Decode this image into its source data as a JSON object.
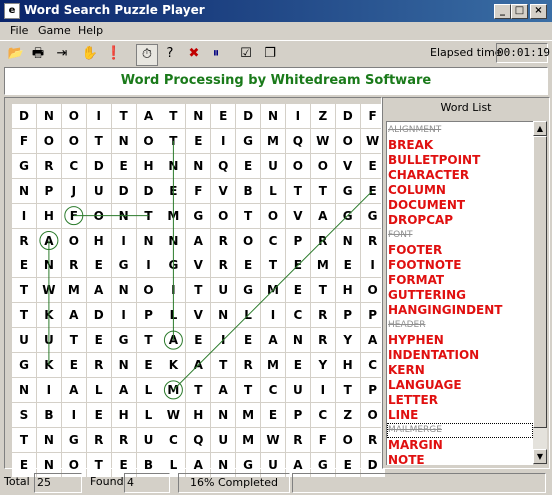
{
  "window": {
    "title": "Word Search Puzzle Player",
    "app_icon": "document-icon"
  },
  "menu": [
    "File",
    "Game",
    "Help"
  ],
  "toolbar": {
    "buttons": [
      {
        "name": "open-button",
        "icon": "folder-open-icon",
        "glyph": "📂"
      },
      {
        "name": "print-button",
        "icon": "printer-icon",
        "glyph": "🖶"
      },
      {
        "name": "exit-button",
        "icon": "exit-door-icon",
        "glyph": "⇥"
      },
      {
        "name": "hand-button",
        "icon": "hand-icon",
        "glyph": "✋"
      },
      {
        "name": "stop-button",
        "icon": "stop-icon",
        "glyph": "❗"
      },
      {
        "name": "timer-button",
        "icon": "stopwatch-icon",
        "glyph": "⏱"
      },
      {
        "name": "hint-button",
        "icon": "hint-icon",
        "glyph": "?"
      },
      {
        "name": "reveal-button",
        "icon": "cross-icon",
        "glyph": "✖"
      },
      {
        "name": "pause-button",
        "icon": "pause-icon",
        "glyph": "⏸"
      },
      {
        "name": "checklist-button",
        "icon": "checklist-icon",
        "glyph": "☑"
      },
      {
        "name": "window-button",
        "icon": "window-icon",
        "glyph": "❐"
      }
    ],
    "elapsed_label": "Elapsed time",
    "elapsed_value": "00:01:19"
  },
  "banner": "Word Processing by Whitedream Software",
  "grid": [
    "DNOITATNEDNIZDF",
    "FOOTNOTEIGMQWOW",
    "GRCDEHNNQEUOOVE",
    "NPJUDDEFVBLTTGE",
    "IHFONTMGOTOVAGG",
    "RAOHINNAROCPRNR",
    "ENREGIGVRETEMEI",
    "TWMANOITUGMETHO",
    "TKADIPLVNLICRPP",
    "UUTEGTAEIEANRYA",
    "GKERNEKATRMEYHC",
    "NIALALMTATCUITP",
    "SBIEHLWHNMEPCZO",
    "TNGRRUCQUMWRFOR",
    "ENOTEBLANGUAGED"
  ],
  "word_list": {
    "header": "Word List",
    "items": [
      {
        "word": "ALIGNMENT",
        "found": true
      },
      {
        "word": "BREAK",
        "found": false
      },
      {
        "word": "BULLETPOINT",
        "found": false
      },
      {
        "word": "CHARACTER",
        "found": false
      },
      {
        "word": "COLUMN",
        "found": false
      },
      {
        "word": "DOCUMENT",
        "found": false
      },
      {
        "word": "DROPCAP",
        "found": false
      },
      {
        "word": "FONT",
        "found": true
      },
      {
        "word": "FOOTER",
        "found": false
      },
      {
        "word": "FOOTNOTE",
        "found": false
      },
      {
        "word": "FORMAT",
        "found": false
      },
      {
        "word": "GUTTERING",
        "found": false
      },
      {
        "word": "HANGINGINDENT",
        "found": false
      },
      {
        "word": "HEADER",
        "found": true
      },
      {
        "word": "HYPHEN",
        "found": false
      },
      {
        "word": "INDENTATION",
        "found": false
      },
      {
        "word": "KERN",
        "found": false
      },
      {
        "word": "LANGUAGE",
        "found": false
      },
      {
        "word": "LETTER",
        "found": false
      },
      {
        "word": "LINE",
        "found": false
      },
      {
        "word": "MAILMERGE",
        "found": true,
        "selected": true
      },
      {
        "word": "MARGIN",
        "found": false
      },
      {
        "word": "NOTE",
        "found": false
      }
    ]
  },
  "status": {
    "total_label": "Total",
    "total_value": "25",
    "found_label": "Found",
    "found_value": "4",
    "progress_text": "16% Completed"
  },
  "colors": {
    "active_word": "#e01010",
    "found_word": "#909090",
    "banner_text": "#1a7a1a",
    "found_line": "#2a7a2a"
  }
}
